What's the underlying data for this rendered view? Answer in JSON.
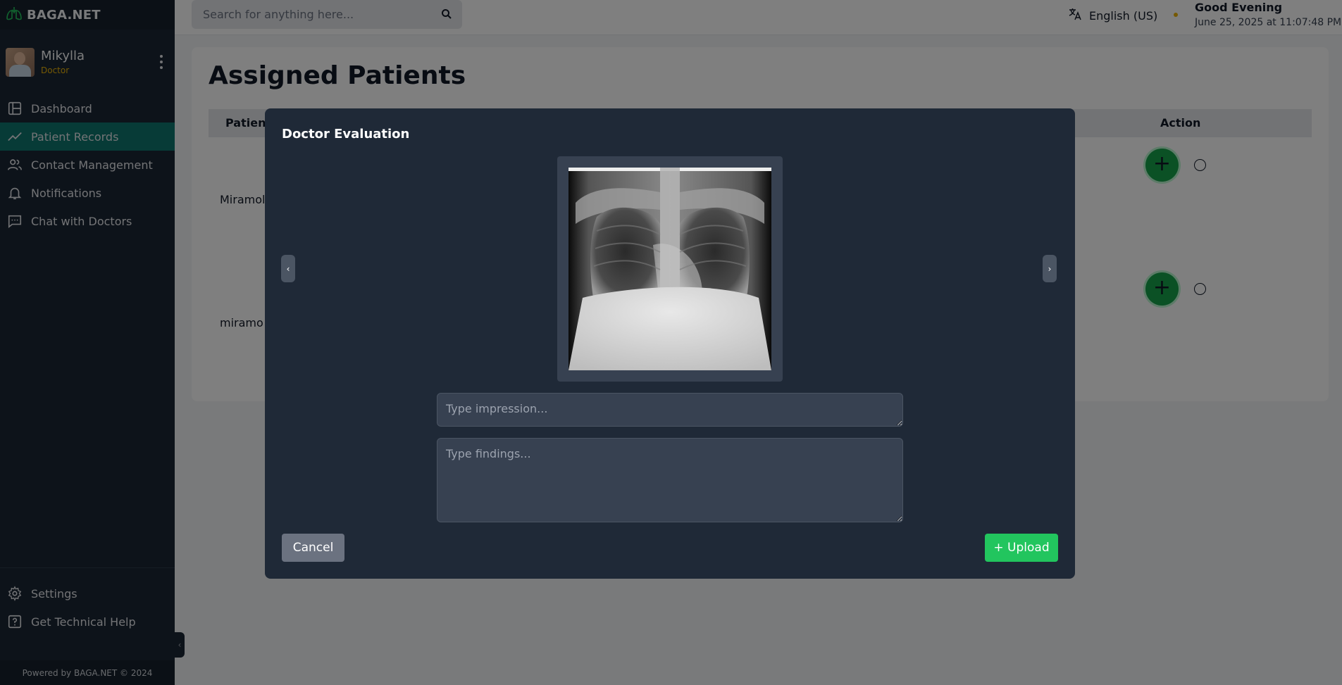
{
  "brand": {
    "name": "BAGA.NET",
    "logo_icon": "lungs-icon"
  },
  "user": {
    "name": "Mikylla",
    "role": "Doctor"
  },
  "sidebar": {
    "items": [
      {
        "label": "Dashboard",
        "icon": "dashboard-icon",
        "active": false
      },
      {
        "label": "Patient Records",
        "icon": "trend-icon",
        "active": true
      },
      {
        "label": "Contact Management",
        "icon": "users-icon",
        "active": false
      },
      {
        "label": "Notifications",
        "icon": "bell-icon",
        "active": false
      },
      {
        "label": "Chat with Doctors",
        "icon": "chat-icon",
        "active": false
      }
    ],
    "bottom_items": [
      {
        "label": "Settings",
        "icon": "gear-icon"
      },
      {
        "label": "Get Technical Help",
        "icon": "help-icon"
      }
    ],
    "footer": "Powered by BAGA.NET © 2024"
  },
  "topbar": {
    "search_placeholder": "Search for anything here...",
    "language": "English (US)",
    "greeting": "Good Evening",
    "datetime": "June 25, 2025 at 11:07:48 PM"
  },
  "main": {
    "title": "Assigned Patients",
    "columns": {
      "patient": "Patient",
      "action": "Action"
    },
    "rows": [
      {
        "name": "Miramol"
      },
      {
        "name": "miramo"
      }
    ]
  },
  "modal": {
    "title": "Doctor Evaluation",
    "impression_placeholder": "Type impression...",
    "findings_placeholder": "Type findings...",
    "cancel_label": "Cancel",
    "upload_label": "+ Upload",
    "prev_label": "‹",
    "next_label": "›"
  },
  "colors": {
    "sidebar": "#1b2634",
    "active_nav": "#0f766e",
    "modal": "#1f2937",
    "upload": "#22c55e",
    "cancel": "#6b7280",
    "role": "#eab308"
  }
}
